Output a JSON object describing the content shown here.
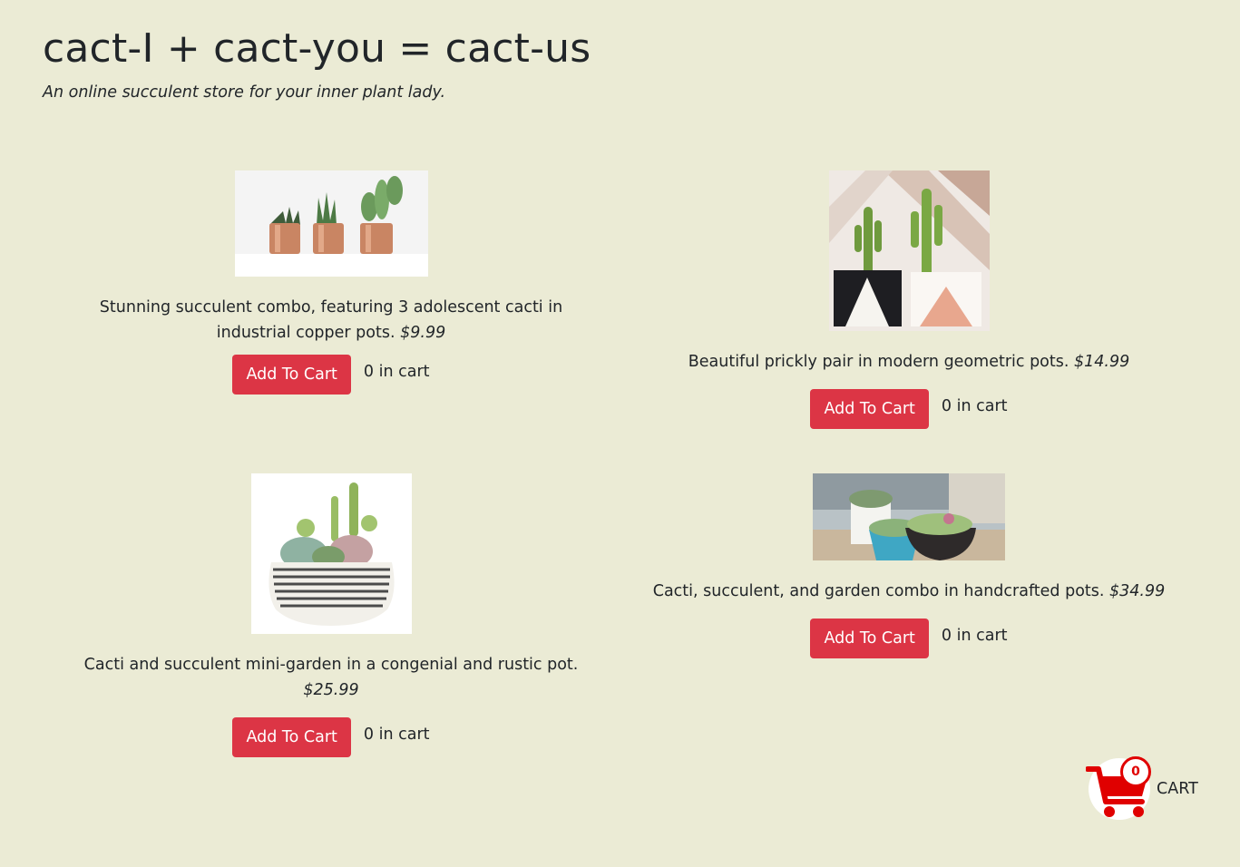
{
  "header": {
    "title": "cact-I + cact-you = cact-us",
    "tagline": "An online succulent store for your inner plant lady."
  },
  "products": [
    {
      "description": "Stunning succulent combo, featuring 3 adolescent cacti in industrial copper pots.",
      "price": "$9.99",
      "button_label": "Add To Cart",
      "cart_status": "0 in cart"
    },
    {
      "description": "Beautiful prickly pair in modern geometric pots.",
      "price": "$14.99",
      "button_label": "Add To Cart",
      "cart_status": "0 in cart"
    },
    {
      "description": "Cacti and succulent mini-garden in a congenial and rustic pot.",
      "price": "$25.99",
      "button_label": "Add To Cart",
      "cart_status": "0 in cart"
    },
    {
      "description": "Cacti, succulent, and garden combo in handcrafted pots.",
      "price": "$34.99",
      "button_label": "Add To Cart",
      "cart_status": "0 in cart"
    }
  ],
  "cart": {
    "badge_count": "0",
    "label": "CART",
    "icon": "shopping-cart-icon",
    "accent_color": "#e00000"
  },
  "colors": {
    "background": "#ebebd5",
    "button": "#dc3545"
  }
}
